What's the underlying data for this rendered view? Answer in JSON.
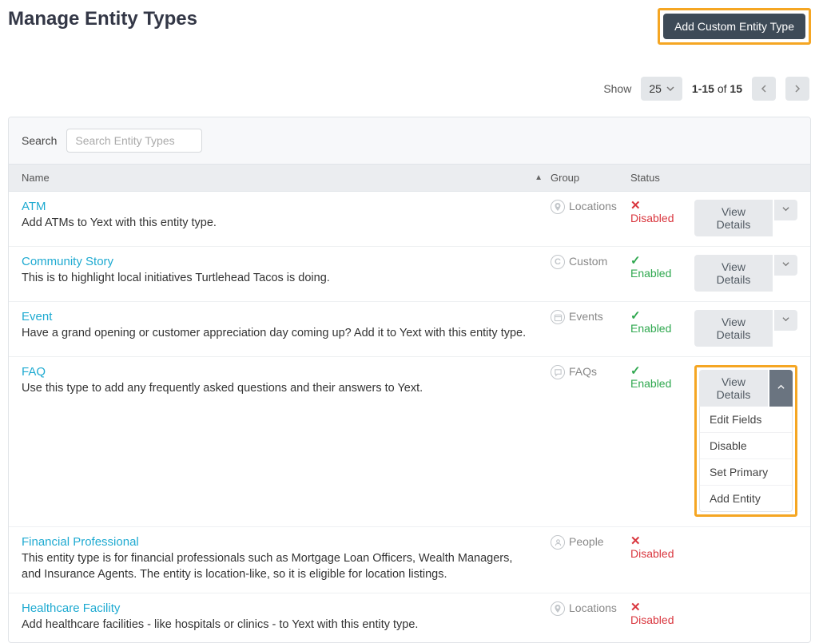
{
  "page_title": "Manage Entity Types",
  "add_button_label": "Add Custom Entity Type",
  "pagination": {
    "show_label": "Show",
    "page_size": "25",
    "range_start": "1-15",
    "range_of": " of ",
    "range_total": "15"
  },
  "search": {
    "label": "Search",
    "placeholder": "Search Entity Types"
  },
  "columns": {
    "name": "Name",
    "group": "Group",
    "status": "Status"
  },
  "actions": {
    "view_details": "View Details",
    "menu": [
      "Edit Fields",
      "Disable",
      "Set Primary",
      "Add Entity"
    ]
  },
  "status_labels": {
    "enabled": "Enabled",
    "disabled": "Disabled"
  },
  "rows": [
    {
      "title": "ATM",
      "desc": "Add ATMs to Yext with this entity type.",
      "group": "Locations",
      "group_icon": "pin-icon",
      "status": "disabled",
      "has_actions": true,
      "dropdown_open": false
    },
    {
      "title": "Community Story",
      "desc": "This is to highlight local initiatives Turtlehead Tacos is doing.",
      "group": "Custom",
      "group_icon": "letter-c-icon",
      "status": "enabled",
      "has_actions": true,
      "dropdown_open": false
    },
    {
      "title": "Event",
      "desc": "Have a grand opening or customer appreciation day coming up? Add it to Yext with this entity type.",
      "group": "Events",
      "group_icon": "calendar-icon",
      "status": "enabled",
      "has_actions": true,
      "dropdown_open": false
    },
    {
      "title": "FAQ",
      "desc": "Use this type to add any frequently asked questions and their answers to Yext.",
      "group": "FAQs",
      "group_icon": "chat-icon",
      "status": "enabled",
      "has_actions": true,
      "dropdown_open": true
    },
    {
      "title": "Financial Professional",
      "desc": "This entity type is for financial professionals such as Mortgage Loan Officers, Wealth Managers, and Insurance Agents. The entity is location-like, so it is eligible for location listings.",
      "group": "People",
      "group_icon": "person-icon",
      "status": "disabled",
      "has_actions": false,
      "dropdown_open": false
    },
    {
      "title": "Healthcare Facility",
      "desc": "Add healthcare facilities - like hospitals or clinics - to Yext with this entity type.",
      "group": "Locations",
      "group_icon": "pin-icon",
      "status": "disabled",
      "has_actions": false,
      "dropdown_open": false
    }
  ]
}
